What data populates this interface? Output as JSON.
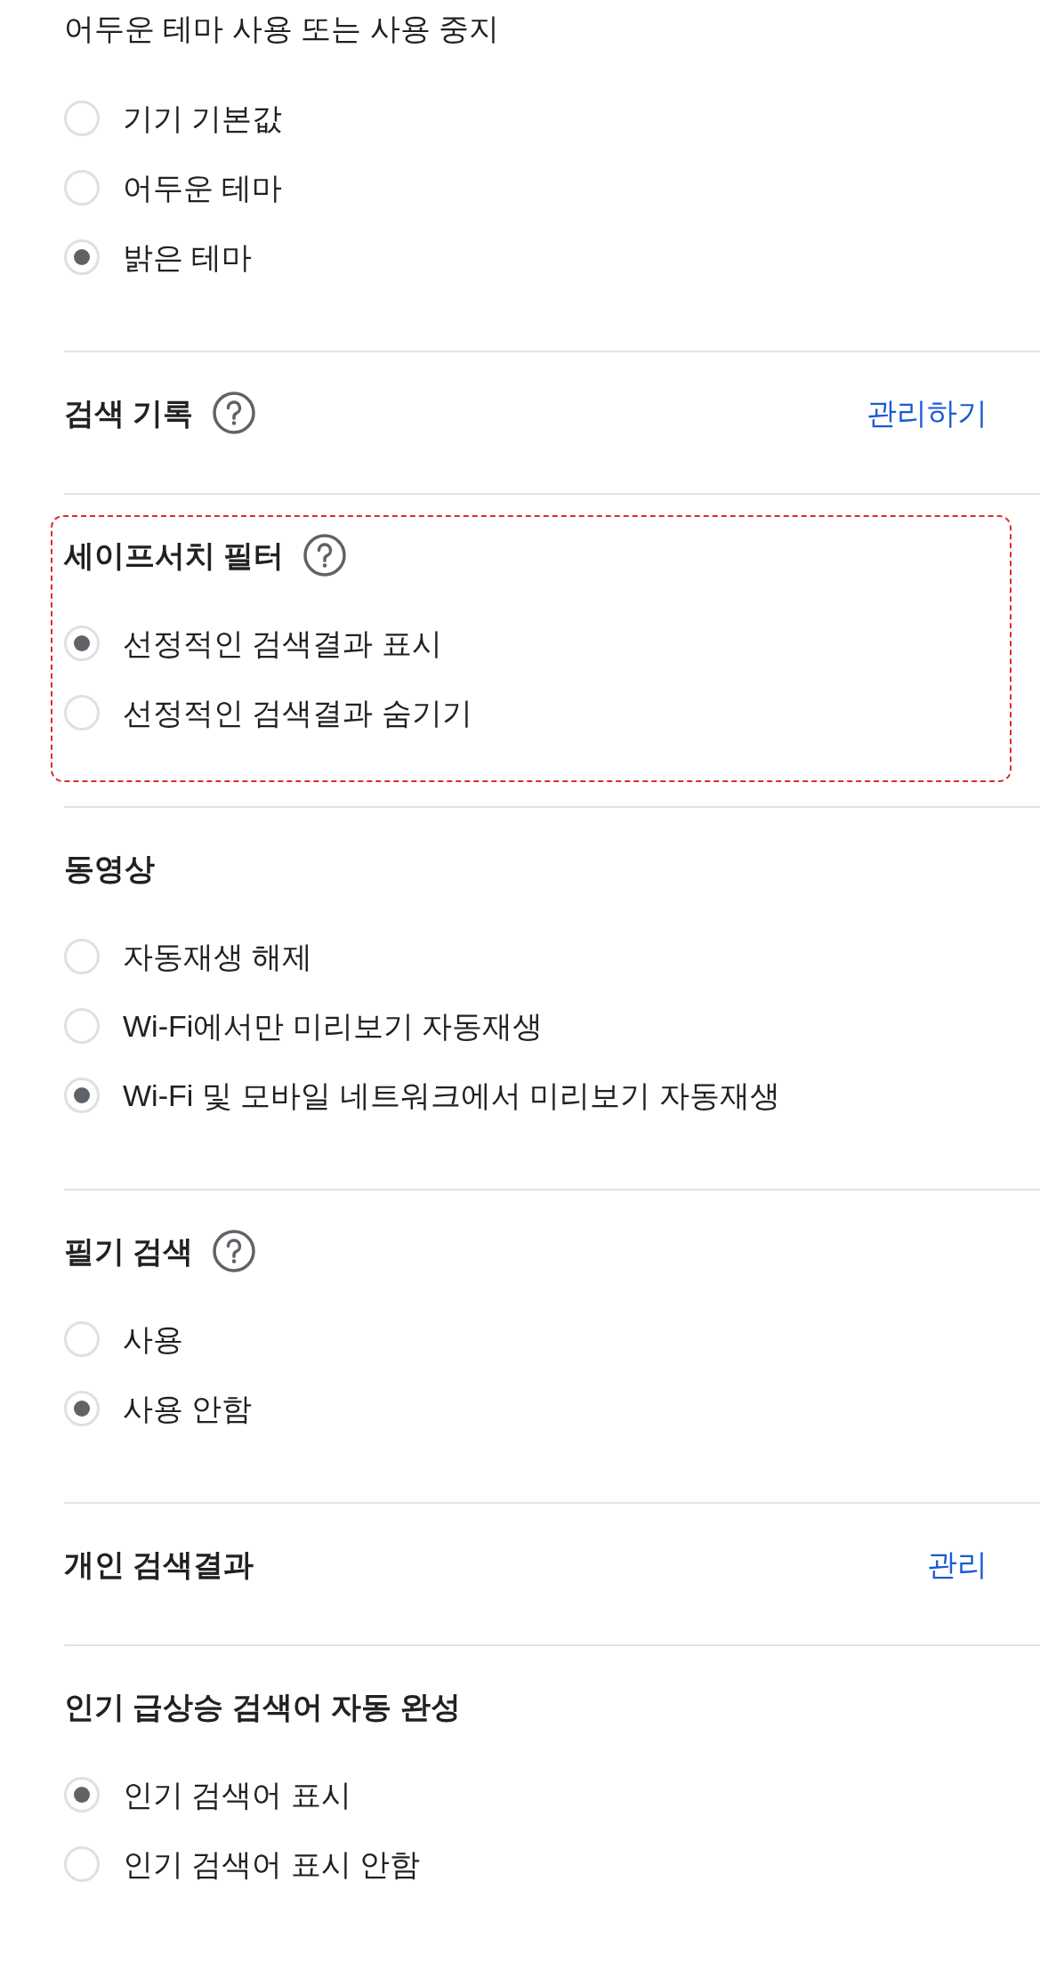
{
  "sections": [
    {
      "kind": "options",
      "highlighted": false,
      "description": "어두운 테마 사용 또는 사용 중지",
      "options": [
        {
          "label": "기기 기본값",
          "selected": false
        },
        {
          "label": "어두운 테마",
          "selected": false
        },
        {
          "label": "밝은 테마",
          "selected": true
        }
      ]
    },
    {
      "kind": "link",
      "highlighted": false,
      "title": "검색 기록",
      "help": true,
      "link": "관리하기"
    },
    {
      "kind": "options",
      "highlighted": true,
      "title": "세이프서치 필터",
      "help": true,
      "options": [
        {
          "label": "선정적인 검색결과 표시",
          "selected": true
        },
        {
          "label": "선정적인 검색결과 숨기기",
          "selected": false
        }
      ]
    },
    {
      "kind": "options",
      "highlighted": false,
      "title": "동영상",
      "help": false,
      "options": [
        {
          "label": "자동재생 해제",
          "selected": false
        },
        {
          "label": "Wi-Fi에서만 미리보기 자동재생",
          "selected": false
        },
        {
          "label": "Wi-Fi 및 모바일 네트워크에서 미리보기 자동재생",
          "selected": true
        }
      ]
    },
    {
      "kind": "options",
      "highlighted": false,
      "title": "필기 검색",
      "help": true,
      "options": [
        {
          "label": "사용",
          "selected": false
        },
        {
          "label": "사용 안함",
          "selected": true
        }
      ]
    },
    {
      "kind": "link",
      "highlighted": false,
      "title": "개인 검색결과",
      "help": false,
      "link": "관리"
    },
    {
      "kind": "options",
      "highlighted": false,
      "title": "인기 급상승 검색어 자동 완성",
      "help": false,
      "options": [
        {
          "label": "인기 검색어 표시",
          "selected": true
        },
        {
          "label": "인기 검색어 표시 안함",
          "selected": false
        }
      ]
    }
  ]
}
